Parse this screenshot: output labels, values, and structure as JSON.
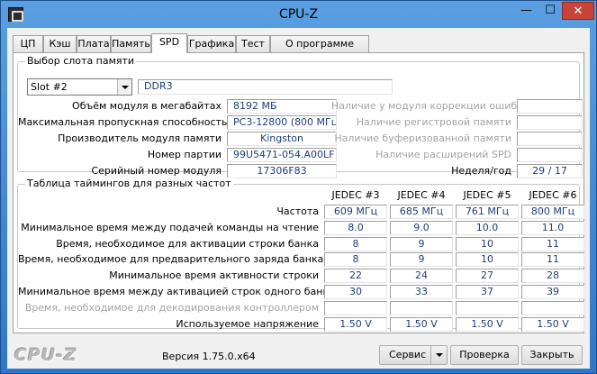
{
  "window": {
    "title": "CPU-Z",
    "min_glyph": "—",
    "max_glyph": "☐",
    "close_glyph": "✕"
  },
  "tabs": [
    {
      "label": "ЦП"
    },
    {
      "label": "Кэш"
    },
    {
      "label": "Плата"
    },
    {
      "label": "Память"
    },
    {
      "label": "SPD",
      "active": true
    },
    {
      "label": "Графика"
    },
    {
      "label": "Тест"
    },
    {
      "label": "О программе"
    }
  ],
  "slot": {
    "legend": "Выбор слота памяти",
    "selected": "Slot #2",
    "type": "DDR3",
    "left_labels": [
      "Объём модуля в мегабайтах",
      "Максимальная пропускная способность",
      "Производитель модуля памяти",
      "Номер партии",
      "Серийный номер модуля"
    ],
    "left_values": [
      "8192 МБ",
      "PC3-12800 (800 МГц)",
      "Kingston",
      "99U5471-054.A00LF",
      "17306F83"
    ],
    "right_labels": [
      "Наличие у модуля коррекции ошибок",
      "Наличие регистровой памяти",
      "Наличие буферизованной памяти",
      "Наличие расширений SPD",
      "Неделя/год"
    ],
    "week_year": "29 / 17"
  },
  "timings": {
    "legend": "Таблица таймингов для разных частот",
    "columns": [
      "JEDEC #3",
      "JEDEC #4",
      "JEDEC #5",
      "JEDEC #6"
    ],
    "rows": [
      {
        "label": "Частота",
        "values": [
          "609 МГц",
          "685 МГц",
          "761 МГц",
          "800 МГц"
        ],
        "dim": false
      },
      {
        "label": "Минимальное время между подачей команды на чтение",
        "values": [
          "8.0",
          "9.0",
          "10.0",
          "11.0"
        ],
        "dim": false
      },
      {
        "label": "Время, необходимое для активации строки банка",
        "values": [
          "8",
          "9",
          "10",
          "11"
        ],
        "dim": false
      },
      {
        "label": "Время, необходимое для предварительного заряда банка",
        "values": [
          "8",
          "9",
          "10",
          "11"
        ],
        "dim": false
      },
      {
        "label": "Минимальное время активности строки",
        "values": [
          "22",
          "24",
          "27",
          "28"
        ],
        "dim": false
      },
      {
        "label": "Минимальное время между активацией строк одного банка",
        "values": [
          "30",
          "33",
          "37",
          "39"
        ],
        "dim": false
      },
      {
        "label": "Время, необходимое для декодирования контроллером",
        "values": [
          "",
          "",
          "",
          ""
        ],
        "dim": true
      },
      {
        "label": "Используемое напряжение",
        "values": [
          "1.50 V",
          "1.50 V",
          "1.50 V",
          "1.50 V"
        ],
        "dim": false
      }
    ]
  },
  "footer": {
    "logo": "CPU-Z",
    "version": "Версия 1.75.0.x64",
    "service_label": "Сервис",
    "check_label": "Проверка",
    "close_label": "Закрыть"
  },
  "colors": {
    "value_text": "#1d3f7a",
    "dim_label": "#a3a3a3",
    "close_button": "#c94438",
    "title_gradient": "#5a9fe0"
  }
}
